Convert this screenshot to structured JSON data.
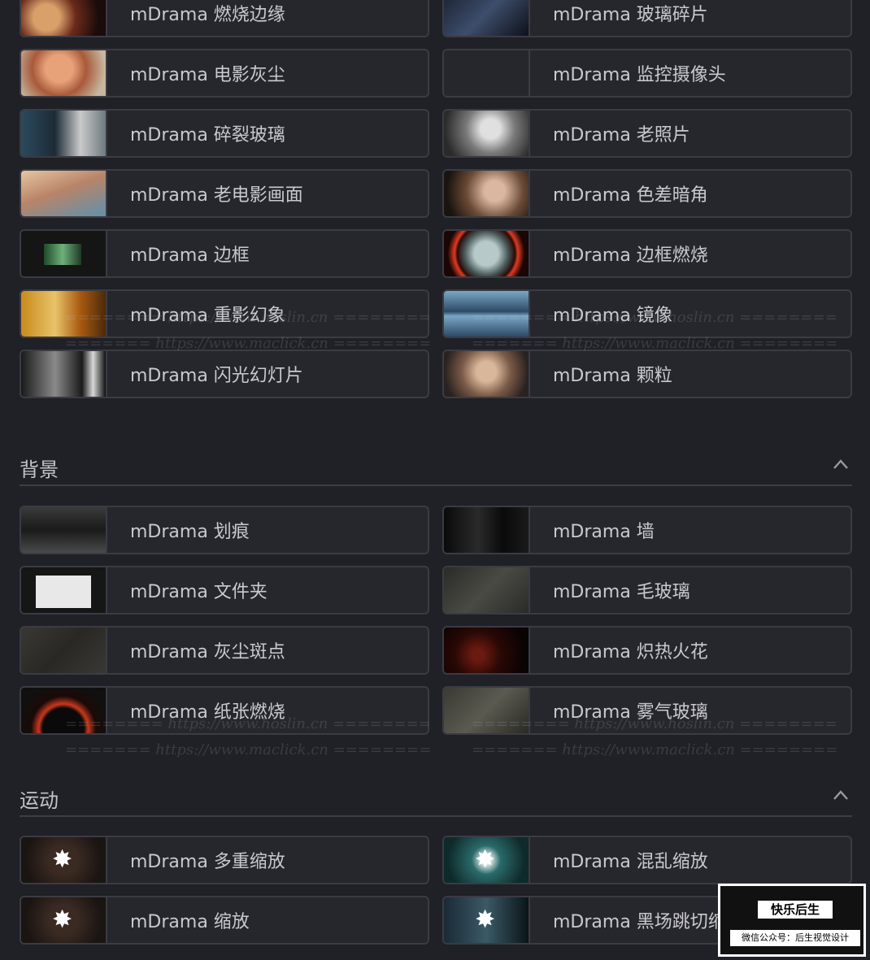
{
  "group1": [
    {
      "label": "mDrama 燃烧边缘",
      "thumb": "t-fire"
    },
    {
      "label": "mDrama 玻璃碎片",
      "thumb": "t-glass"
    },
    {
      "label": "mDrama 电影灰尘",
      "thumb": "t-redhead"
    },
    {
      "label": "mDrama 监控摄像头",
      "thumb": "t-empty"
    },
    {
      "label": "mDrama 碎裂玻璃",
      "thumb": "t-shatter"
    },
    {
      "label": "mDrama 老照片",
      "thumb": "t-bw"
    },
    {
      "label": "mDrama 老电影画面",
      "thumb": "t-sleep"
    },
    {
      "label": "mDrama 色差暗角",
      "thumb": "t-old"
    },
    {
      "label": "mDrama 边框",
      "thumb": "t-frame"
    },
    {
      "label": "mDrama 边框燃烧",
      "thumb": "t-burnframe"
    },
    {
      "label": "mDrama 重影幻象",
      "thumb": "t-ghost"
    },
    {
      "label": "mDrama 镜像",
      "thumb": "t-mirror"
    },
    {
      "label": "mDrama 闪光幻灯片",
      "thumb": "t-flash"
    },
    {
      "label": "mDrama 颗粒",
      "thumb": "t-grain"
    }
  ],
  "section_bg": {
    "title": "背景"
  },
  "group2": [
    {
      "label": "mDrama 划痕",
      "thumb": "t-scratch"
    },
    {
      "label": "mDrama 墙",
      "thumb": "t-wall"
    },
    {
      "label": "mDrama 文件夹",
      "thumb": "t-folder"
    },
    {
      "label": "mDrama 毛玻璃",
      "thumb": "t-frost"
    },
    {
      "label": "mDrama 灰尘斑点",
      "thumb": "t-dust"
    },
    {
      "label": "mDrama 炽热火花",
      "thumb": "t-spark"
    },
    {
      "label": "mDrama 纸张燃烧",
      "thumb": "t-paper"
    },
    {
      "label": "mDrama 雾气玻璃",
      "thumb": "t-fog"
    }
  ],
  "section_motion": {
    "title": "运动"
  },
  "group3": [
    {
      "label": "mDrama 多重缩放",
      "thumb": "t-zoom"
    },
    {
      "label": "mDrama 混乱缩放",
      "thumb": "t-chaos"
    },
    {
      "label": "mDrama 缩放",
      "thumb": "t-zoom"
    },
    {
      "label": "mDrama 黑场跳切缩放",
      "thumb": "t-blackcut"
    }
  ],
  "watermarks": {
    "hoslin": "======== https://www.hoslin.cn ========",
    "maclick": "======= https://www.maclick.cn ========"
  },
  "promo": {
    "brand": "快乐后生",
    "account": "微信公众号：后生视觉设计"
  }
}
